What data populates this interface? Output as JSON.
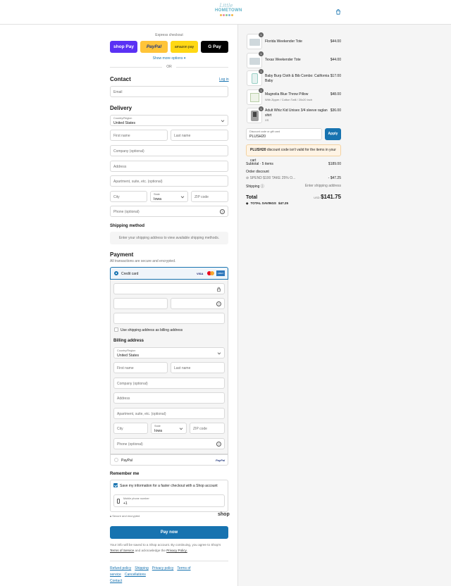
{
  "header": {
    "logo_line1": "Little",
    "logo_line2": "HOMETOWN"
  },
  "express": {
    "title": "Express checkout",
    "shop_pay": "shop Pay",
    "paypal": "PayPal",
    "amazon": "amazon pay",
    "gpay": "G Pay",
    "more": "Show more options",
    "or": "OR"
  },
  "contact": {
    "title": "Contact",
    "login": "Log in",
    "email_placeholder": "Email"
  },
  "delivery": {
    "title": "Delivery",
    "country_label": "Country/Region",
    "country": "United States",
    "first_name": "First name",
    "last_name": "Last name",
    "company": "Company (optional)",
    "address": "Address",
    "apartment": "Apartment, suite, etc. (optional)",
    "city": "City",
    "state_label": "State",
    "state": "Iowa",
    "zip": "ZIP code",
    "phone": "Phone (optional)"
  },
  "shipping": {
    "title": "Shipping method",
    "note": "Enter your shipping address to view available shipping methods."
  },
  "payment": {
    "title": "Payment",
    "subtitle": "All transactions are secure and encrypted.",
    "credit_card": "Credit card",
    "visa": "VISA",
    "amex": "AMEX",
    "use_shipping": "Use shipping address as billing address",
    "paypal": "PayPal",
    "paypal_logo": "PayPal"
  },
  "billing": {
    "title": "Billing address",
    "country_label": "Country/Region",
    "country": "United States",
    "first_name": "First name",
    "last_name": "Last name",
    "company": "Company (optional)",
    "address": "Address",
    "apartment": "Apartment, suite, etc. (optional)",
    "city": "City",
    "state_label": "State",
    "state": "Iowa",
    "zip": "ZIP code",
    "phone": "Phone (optional)"
  },
  "remember": {
    "title": "Remember me",
    "save_info": "Save my information for a faster checkout with a Shop account",
    "mobile_label": "Mobile phone number",
    "mobile_value": "+1",
    "secure": "Secure and encrypted",
    "shop": "shop"
  },
  "pay_now": "Pay now",
  "legal": {
    "text1": "Your info will be saved to a Shop account. By continuing, you agree to Shop's",
    "tos": "Terms of Service",
    "text2": "and acknowledge the",
    "privacy": "Privacy Policy."
  },
  "footer_links": [
    "Refund policy",
    "Shipping",
    "Privacy policy",
    "Terms of service",
    "Cancellations",
    "Contact"
  ],
  "cart": {
    "items": [
      {
        "name": "Florida Weekender Tote",
        "variant": "",
        "qty": "1",
        "price": "$44.00"
      },
      {
        "name": "Texas Weekender Tote",
        "variant": "",
        "qty": "1",
        "price": "$44.00"
      },
      {
        "name": "Baby Burp Cloth & Bib Combo: California Baby",
        "variant": "",
        "qty": "1",
        "price": "$17.00"
      },
      {
        "name": "Magnolia Blue Throw Pillow",
        "variant": "With Zipper / Cotton Twill / 20x20 inch",
        "qty": "1",
        "price": "$48.00"
      },
      {
        "name": "Adult Whiz Kid Unisex 3/4 sleeve raglan shirt",
        "variant": "XS",
        "qty": "1",
        "price": "$36.00"
      }
    ],
    "discount_label": "Discount code or gift card",
    "discount_value": "PLUSH20",
    "apply": "Apply",
    "error_code": "PLUSH20",
    "error_text": "discount code isn't valid for the items in your cart",
    "subtotal_label": "Subtotal · 5 items",
    "subtotal": "$189.00",
    "order_discount": "Order discount",
    "discount_name": "SPEND $100 TAKE 25% O...",
    "discount_amount": "- $47.25",
    "shipping_label": "Shipping",
    "shipping_value": "Enter shipping address",
    "total_label": "Total",
    "currency": "USD",
    "total": "$141.75",
    "savings_label": "TOTAL SAVINGS",
    "savings": "$47.25"
  },
  "colors": {
    "accent": "#1773b0",
    "shop_pay": "#5a31f4",
    "paypal": "#ffc439",
    "amazon": "#ffd814"
  }
}
